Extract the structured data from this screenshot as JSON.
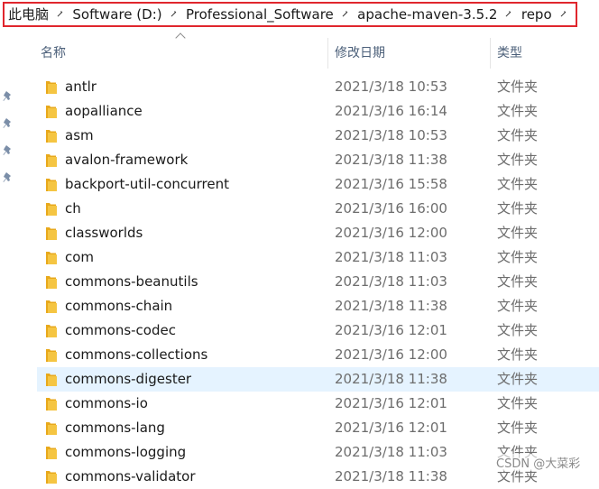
{
  "breadcrumb": {
    "items": [
      {
        "label": "此电脑"
      },
      {
        "label": "Software (D:)"
      },
      {
        "label": "Professional_Software"
      },
      {
        "label": "apache-maven-3.5.2"
      },
      {
        "label": "repo"
      }
    ]
  },
  "columns": {
    "name": "名称",
    "date": "修改日期",
    "type": "类型"
  },
  "colors": {
    "highlight_border": "#e0262d",
    "hover_row": "#e5f3ff",
    "folder_yellow": "#f5c542",
    "header_text": "#4c607a"
  },
  "files": [
    {
      "name": "antlr",
      "date": "2021/3/18 10:53",
      "type": "文件夹",
      "icon": "folder-icon"
    },
    {
      "name": "aopalliance",
      "date": "2021/3/16 16:14",
      "type": "文件夹",
      "icon": "folder-icon"
    },
    {
      "name": "asm",
      "date": "2021/3/18 10:53",
      "type": "文件夹",
      "icon": "folder-icon"
    },
    {
      "name": "avalon-framework",
      "date": "2021/3/18 11:38",
      "type": "文件夹",
      "icon": "folder-icon"
    },
    {
      "name": "backport-util-concurrent",
      "date": "2021/3/16 15:58",
      "type": "文件夹",
      "icon": "folder-icon"
    },
    {
      "name": "ch",
      "date": "2021/3/16 16:00",
      "type": "文件夹",
      "icon": "folder-icon"
    },
    {
      "name": "classworlds",
      "date": "2021/3/16 12:00",
      "type": "文件夹",
      "icon": "folder-icon"
    },
    {
      "name": "com",
      "date": "2021/3/18 11:03",
      "type": "文件夹",
      "icon": "folder-icon"
    },
    {
      "name": "commons-beanutils",
      "date": "2021/3/18 11:03",
      "type": "文件夹",
      "icon": "folder-icon"
    },
    {
      "name": "commons-chain",
      "date": "2021/3/18 11:38",
      "type": "文件夹",
      "icon": "folder-icon"
    },
    {
      "name": "commons-codec",
      "date": "2021/3/16 12:01",
      "type": "文件夹",
      "icon": "folder-icon"
    },
    {
      "name": "commons-collections",
      "date": "2021/3/16 12:00",
      "type": "文件夹",
      "icon": "folder-icon"
    },
    {
      "name": "commons-digester",
      "date": "2021/3/18 11:38",
      "type": "文件夹",
      "icon": "folder-icon",
      "hovered": true
    },
    {
      "name": "commons-io",
      "date": "2021/3/16 12:01",
      "type": "文件夹",
      "icon": "folder-icon"
    },
    {
      "name": "commons-lang",
      "date": "2021/3/16 12:01",
      "type": "文件夹",
      "icon": "folder-icon"
    },
    {
      "name": "commons-logging",
      "date": "2021/3/18 11:03",
      "type": "文件夹",
      "icon": "folder-icon"
    },
    {
      "name": "commons-validator",
      "date": "2021/3/18 11:38",
      "type": "文件夹",
      "icon": "folder-icon"
    }
  ],
  "watermark": "CSDN @大菜彩"
}
